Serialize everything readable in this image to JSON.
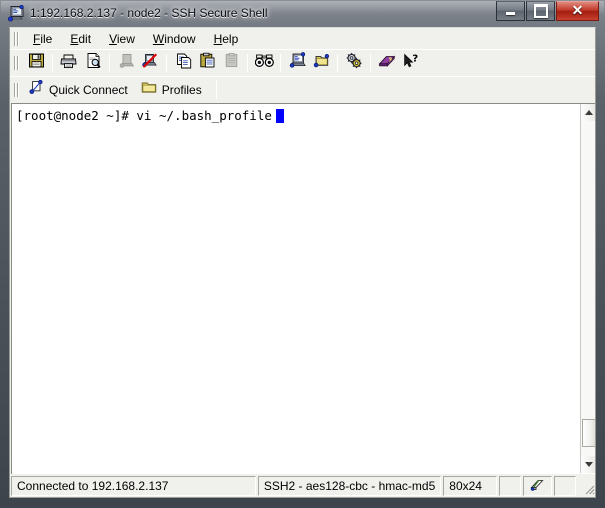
{
  "window": {
    "title": "1:192.168.2.137 - node2 - SSH Secure Shell",
    "icon": "ssh-terminal-icon",
    "controls": {
      "minimize_label": "–",
      "minimize_name": "minimize-button",
      "maximize_label": "□",
      "maximize_name": "maximize-button",
      "close_label": "✕",
      "close_name": "close-button"
    }
  },
  "menubar": {
    "items": [
      {
        "label": "File",
        "mnemonic": "F",
        "rest": "ile"
      },
      {
        "label": "Edit",
        "mnemonic": "E",
        "rest": "dit"
      },
      {
        "label": "View",
        "mnemonic": "V",
        "rest": "iew"
      },
      {
        "label": "Window",
        "mnemonic": "W",
        "rest": "indow"
      },
      {
        "label": "Help",
        "mnemonic": "H",
        "rest": "elp"
      }
    ]
  },
  "toolbar": {
    "buttons": [
      {
        "name": "save-icon",
        "title": "Save"
      },
      {
        "sep": true
      },
      {
        "name": "print-icon",
        "title": "Print"
      },
      {
        "name": "print-preview-icon",
        "title": "Print Preview"
      },
      {
        "sep": true
      },
      {
        "name": "connect-icon",
        "title": "Connect",
        "disabled": true
      },
      {
        "name": "disconnect-icon",
        "title": "Disconnect"
      },
      {
        "sep": true
      },
      {
        "name": "copy-icon",
        "title": "Copy"
      },
      {
        "name": "paste-icon",
        "title": "Paste"
      },
      {
        "name": "print-clipboard-icon",
        "title": "Print Clipboard",
        "disabled": true
      },
      {
        "sep": true
      },
      {
        "name": "find-icon",
        "title": "Find"
      },
      {
        "sep": true
      },
      {
        "name": "new-file-transfer-icon",
        "title": "New File Transfer Window"
      },
      {
        "name": "new-terminal-icon",
        "title": "New Terminal Window"
      },
      {
        "sep": true
      },
      {
        "name": "settings-icon",
        "title": "Settings"
      },
      {
        "sep": true
      },
      {
        "name": "help-book-icon",
        "title": "Help"
      },
      {
        "name": "context-help-icon",
        "title": "Context Help"
      }
    ]
  },
  "connectbar": {
    "quick_connect_label": "Quick Connect",
    "quick_connect_icon": "quick-connect-icon",
    "profiles_label": "Profiles",
    "profiles_icon": "folder-icon"
  },
  "terminal": {
    "prompt_line": "[root@node2 ~]# vi ~/.bash_profile",
    "cursor_color": "#0000ff",
    "background": "#ffffff",
    "foreground": "#000000",
    "cols": 80,
    "rows": 24
  },
  "scrollbar": {
    "up_arrow_name": "scroll-up-arrow",
    "down_arrow_name": "scroll-down-arrow",
    "thumb_name": "scroll-thumb"
  },
  "statusbar": {
    "connection": "Connected to 192.168.2.137",
    "cipher": "SSH2 - aes128-cbc - hmac-md5",
    "terminal_size": "80x24",
    "blank1": "",
    "blank2": "",
    "status_icon": "transfer-status-icon"
  },
  "colors": {
    "frame_dark": "#4b5159",
    "chrome": "#f0f0ed",
    "close_red": "#c0392b",
    "cursor_blue": "#0000ff",
    "terminal_bg": "#ffffff"
  }
}
